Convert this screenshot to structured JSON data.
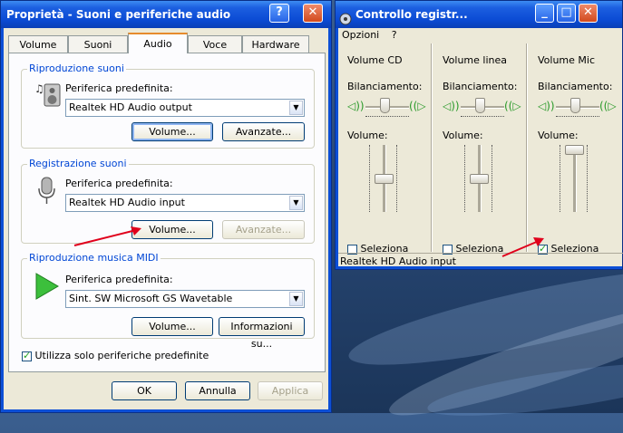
{
  "left_window": {
    "title": "Proprietà - Suoni e periferiche audio",
    "title_buttons": [
      "?",
      "✕"
    ],
    "tabs": [
      {
        "label": "Volume"
      },
      {
        "label": "Suoni"
      },
      {
        "label": "Audio"
      },
      {
        "label": "Voce"
      },
      {
        "label": "Hardware"
      }
    ],
    "active_tab": "Audio",
    "groups": {
      "playback": {
        "title": "Riproduzione suoni",
        "label": "Periferica predefinita:",
        "device": "Realtek HD Audio output",
        "btn_volume": "Volume...",
        "btn_advanced": "Avanzate..."
      },
      "recording": {
        "title": "Registrazione suoni",
        "label": "Periferica predefinita:",
        "device": "Realtek HD Audio input",
        "btn_volume": "Volume...",
        "btn_advanced": "Avanzate..."
      },
      "midi": {
        "title": "Riproduzione musica MIDI",
        "label": "Periferica predefinita:",
        "device": "Sint. SW Microsoft GS Wavetable",
        "btn_volume": "Volume...",
        "btn_info": "Informazioni su..."
      }
    },
    "use_default_only": {
      "label": "Utilizza solo periferiche predefinite",
      "checked": true
    },
    "buttons": {
      "ok": "OK",
      "cancel": "Annulla",
      "apply": "Applica"
    }
  },
  "right_window": {
    "title": "Controllo registr...",
    "menu": [
      "Opzioni",
      "?"
    ],
    "channels": [
      {
        "name": "Volume CD",
        "balance_label": "Bilanciamento:",
        "volume_label": "Volume:",
        "select_label": "Seleziona",
        "selected": false,
        "volume_level": 0.5
      },
      {
        "name": "Volume linea",
        "balance_label": "Bilanciamento:",
        "volume_label": "Volume:",
        "select_label": "Seleziona",
        "selected": false,
        "volume_level": 0.5
      },
      {
        "name": "Volume Mic",
        "balance_label": "Bilanciamento:",
        "volume_label": "Volume:",
        "select_label": "Seleziona",
        "selected": true,
        "volume_level": 1.0
      }
    ],
    "status": "Realtek HD Audio input"
  },
  "annotation_color": "#e0001b"
}
